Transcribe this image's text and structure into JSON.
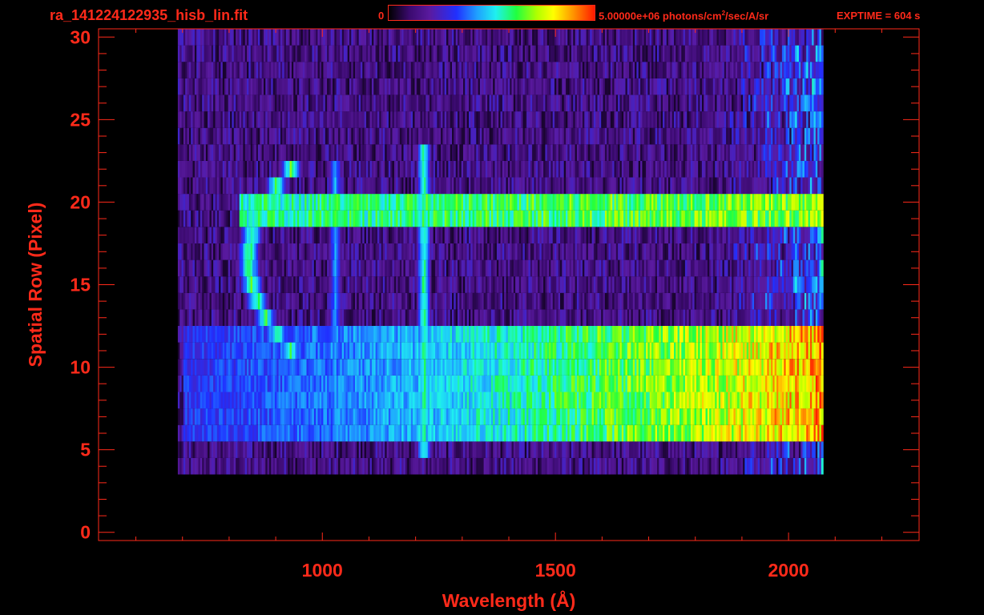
{
  "header": {
    "title": "ra_141224122935_hisb_lin.fit",
    "colorbar_min_label": "0",
    "colorbar_max_label": "5.00000e+06 photons/cm",
    "colorbar_max_label_sup": "2",
    "colorbar_max_label_tail": "/sec/A/sr",
    "exptime_label": "EXPTIME = 604 s"
  },
  "colors": {
    "axis": "#ff2a1a",
    "background": "#000000"
  },
  "chart_data": {
    "type": "heatmap",
    "title": "ra_141224122935_hisb_lin.fit",
    "xlabel": "Wavelength (Å)",
    "ylabel": "Spatial Row (Pixel)",
    "xlim": [
      520,
      2280
    ],
    "ylim": [
      -0.5,
      30.5
    ],
    "x_ticks": [
      1000,
      1500,
      2000
    ],
    "y_ticks": [
      0,
      5,
      10,
      15,
      20,
      25,
      30
    ],
    "colorscale": {
      "min": 0,
      "max": 5000000,
      "units": "photons/cm^2/sec/A/sr",
      "colors": [
        "#000000",
        "#3a0a6e",
        "#5a1aa0",
        "#2030ff",
        "#1fa0ff",
        "#1ff0f0",
        "#20ff40",
        "#b0ff00",
        "#ffff00",
        "#ff9000",
        "#ff1a00"
      ]
    },
    "features": [
      {
        "kind": "noise_floor",
        "x_range": [
          690,
          2070
        ],
        "rows": [
          4,
          30
        ],
        "intensity": 0.13
      },
      {
        "kind": "continuum",
        "x_range": [
          700,
          2070
        ],
        "rows": [
          6,
          12
        ],
        "start_intensity": 0.3,
        "end_intensity": 0.88
      },
      {
        "kind": "continuum",
        "x_range": [
          820,
          2070
        ],
        "rows": [
          19,
          20
        ],
        "start_intensity": 0.55,
        "end_intensity": 0.7
      },
      {
        "kind": "emission_line",
        "wavelength": 1216,
        "rows": [
          5,
          23
        ],
        "intensity": 0.6
      },
      {
        "kind": "emission_line",
        "wavelength": 1026,
        "rows": [
          6,
          22
        ],
        "intensity": 0.42
      },
      {
        "kind": "arc",
        "center_row": 16.5,
        "half_height_rows": 5.5,
        "x_at_center": 840,
        "x_at_ends": 930,
        "intensity": 0.62
      }
    ]
  }
}
